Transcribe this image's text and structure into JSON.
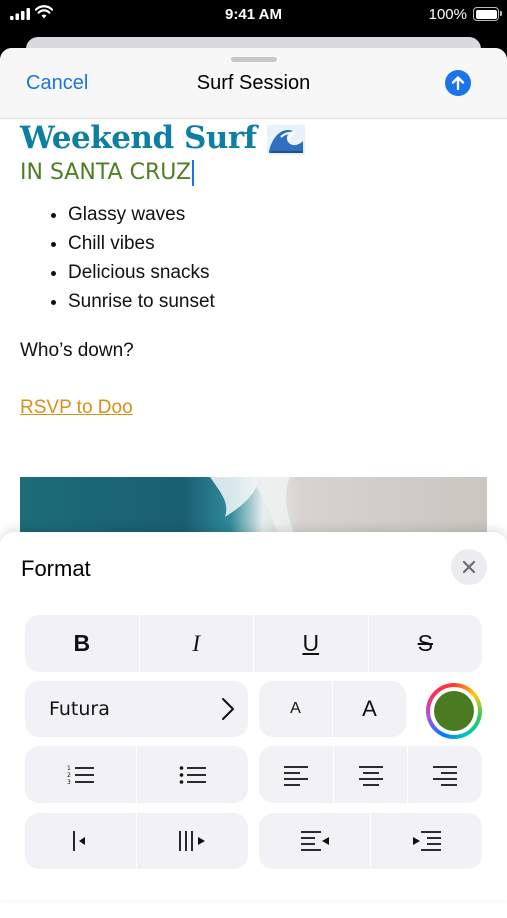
{
  "status_bar": {
    "time": "9:41 AM",
    "battery": "100%"
  },
  "nav": {
    "cancel": "Cancel",
    "title": "Surf Session"
  },
  "note": {
    "heading": "Weekend Surf",
    "subheading": "IN SANTA CRUZ",
    "bullets": [
      "Glassy waves",
      "Chill vibes",
      "Delicious snacks",
      "Sunrise to sunset"
    ],
    "question": "Who’s down?",
    "link": "RSVP to Doo"
  },
  "format_panel": {
    "title": "Format",
    "style_buttons": {
      "bold": "B",
      "italic": "I",
      "underline": "U",
      "strikethrough": "S"
    },
    "font_name": "Futura",
    "font_size_small": "A",
    "font_size_large": "A",
    "selected_color": "#4a7a22"
  },
  "colors": {
    "accent": "#1a73e8",
    "heading": "#0e7ea3",
    "subheading": "#4e7f23",
    "link": "#d9901a"
  }
}
